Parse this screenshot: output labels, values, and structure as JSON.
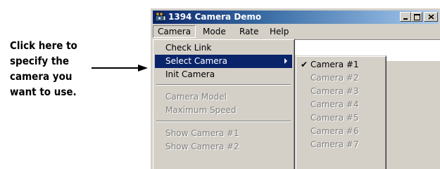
{
  "annotation": {
    "lines": [
      "Click here to",
      "specify the",
      "camera you",
      "want to use."
    ]
  },
  "window": {
    "title": "1394 Camera Demo",
    "icon": "camera-app-icon",
    "titlebar_colors": [
      "#0a246a",
      "#a6caf0"
    ]
  },
  "menubar": {
    "items": [
      "Camera",
      "Mode",
      "Rate",
      "Help"
    ],
    "active": "Camera"
  },
  "camera_menu": {
    "items": [
      {
        "label": "Check Link",
        "enabled": true
      },
      {
        "label": "Select Camera",
        "enabled": true,
        "highlighted": true,
        "has_submenu": true
      },
      {
        "label": "Init Camera",
        "enabled": true
      },
      {
        "label": "Camera Model",
        "enabled": false
      },
      {
        "label": "Maximum Speed",
        "enabled": false
      },
      {
        "label": "Show Camera #1",
        "enabled": false
      },
      {
        "label": "Show Camera #2",
        "enabled": false
      }
    ]
  },
  "select_camera_submenu": {
    "checkmark": "✔",
    "items": [
      {
        "label": "Camera #1",
        "enabled": true,
        "checked": true
      },
      {
        "label": "Camera #2",
        "enabled": false
      },
      {
        "label": "Camera #3",
        "enabled": false
      },
      {
        "label": "Camera #4",
        "enabled": false
      },
      {
        "label": "Camera #5",
        "enabled": false
      },
      {
        "label": "Camera #6",
        "enabled": false
      },
      {
        "label": "Camera #7",
        "enabled": false
      }
    ]
  },
  "colors": {
    "face": "#d4d0c8",
    "highlight": "#0a246a",
    "disabled_text": "#808080"
  }
}
